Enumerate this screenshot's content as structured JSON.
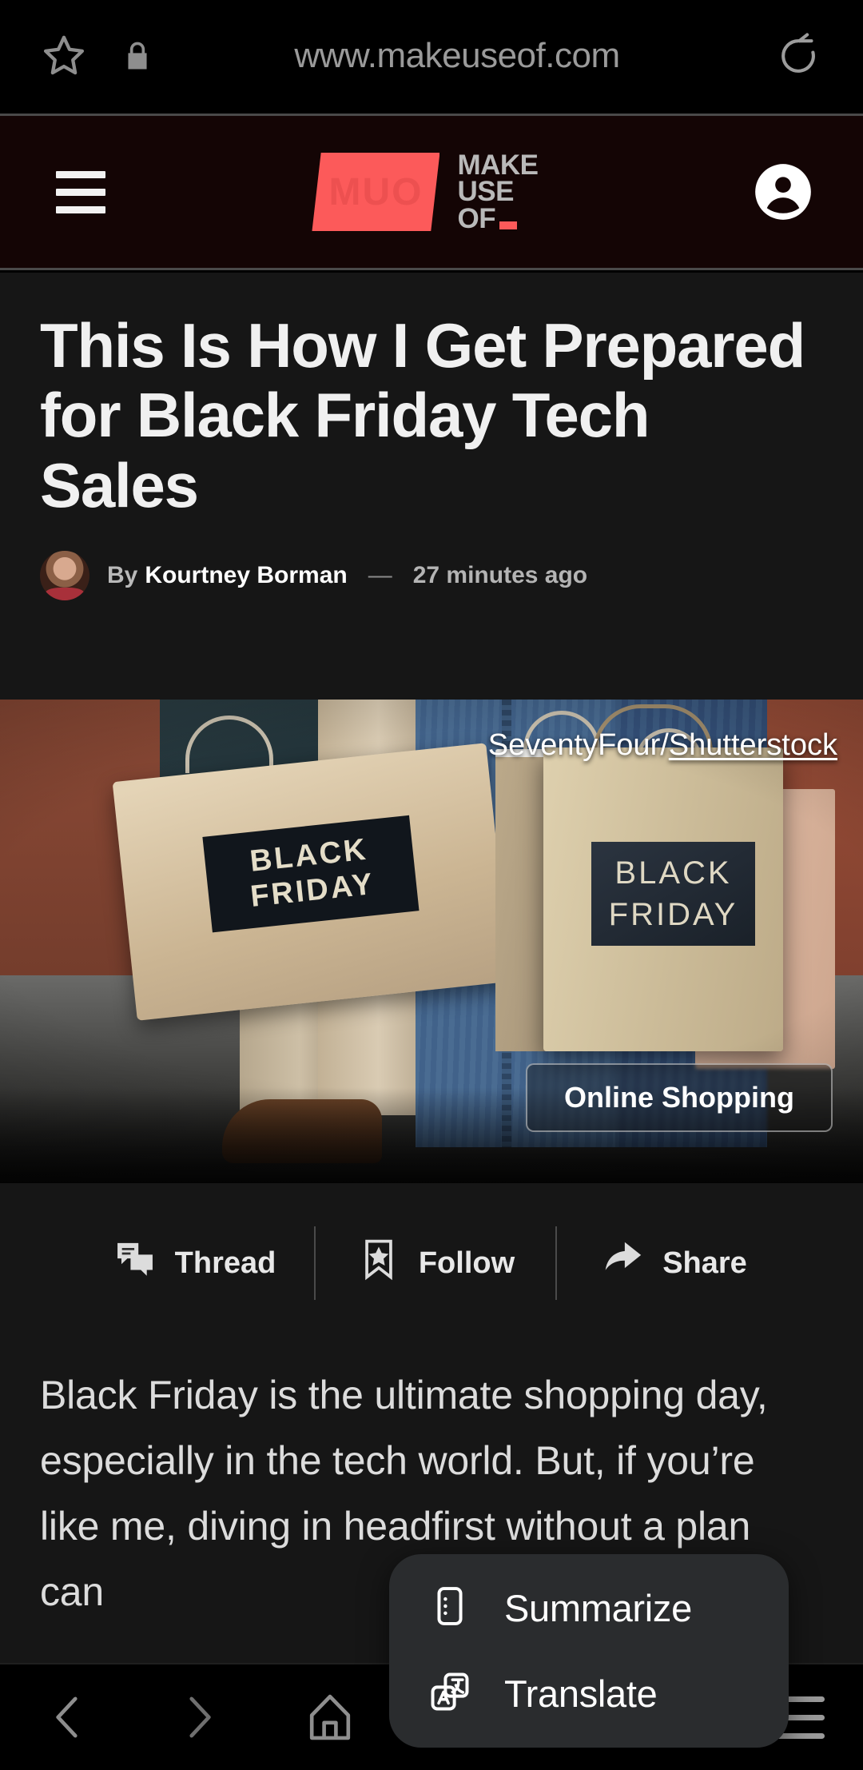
{
  "browser": {
    "url": "www.makeuseof.com",
    "star_icon": "star-icon",
    "lock_icon": "lock-icon",
    "reload_icon": "reload-icon"
  },
  "site_header": {
    "menu_icon": "hamburger-menu-icon",
    "logo_mark_text": "MUO",
    "logo_line1": "MAKE",
    "logo_line2": "USE",
    "logo_line3": "OF",
    "account_icon": "account-icon",
    "brand_color": "#fc5a5a"
  },
  "article": {
    "title": "This Is How I Get Prepared for Black Friday Tech Sales",
    "byline_prefix": "By",
    "author": "Kourtney Borman",
    "separator": "—",
    "timestamp": "27 minutes ago",
    "hero": {
      "credit_prefix": "SeventyFour/",
      "credit_link": "Shutterstock",
      "tag": "Online Shopping",
      "bag_label_line1": "BLACK",
      "bag_label_line2": "FRIDAY",
      "bag_label2_line1": "BLACK",
      "bag_label2_line2": "FRIDAY"
    },
    "body_paragraph": "Black Friday is the ultimate shopping day, especially in the tech world. But, if you’re like me, diving in headfirst without a plan can"
  },
  "actions": [
    {
      "label": "Thread",
      "icon": "chat-bubbles-icon"
    },
    {
      "label": "Follow",
      "icon": "bookmark-star-icon"
    },
    {
      "label": "Share",
      "icon": "share-arrow-icon"
    }
  ],
  "popup": {
    "items": [
      {
        "label": "Summarize",
        "icon": "summarize-icon"
      },
      {
        "label": "Translate",
        "icon": "translate-icon"
      }
    ],
    "background_color": "#2a2c2e"
  },
  "bottom_nav": [
    {
      "name": "back",
      "icon": "chevron-left-icon"
    },
    {
      "name": "forward",
      "icon": "chevron-right-icon"
    },
    {
      "name": "home",
      "icon": "home-icon"
    },
    {
      "name": "menu",
      "icon": "hamburger-menu-icon"
    }
  ]
}
